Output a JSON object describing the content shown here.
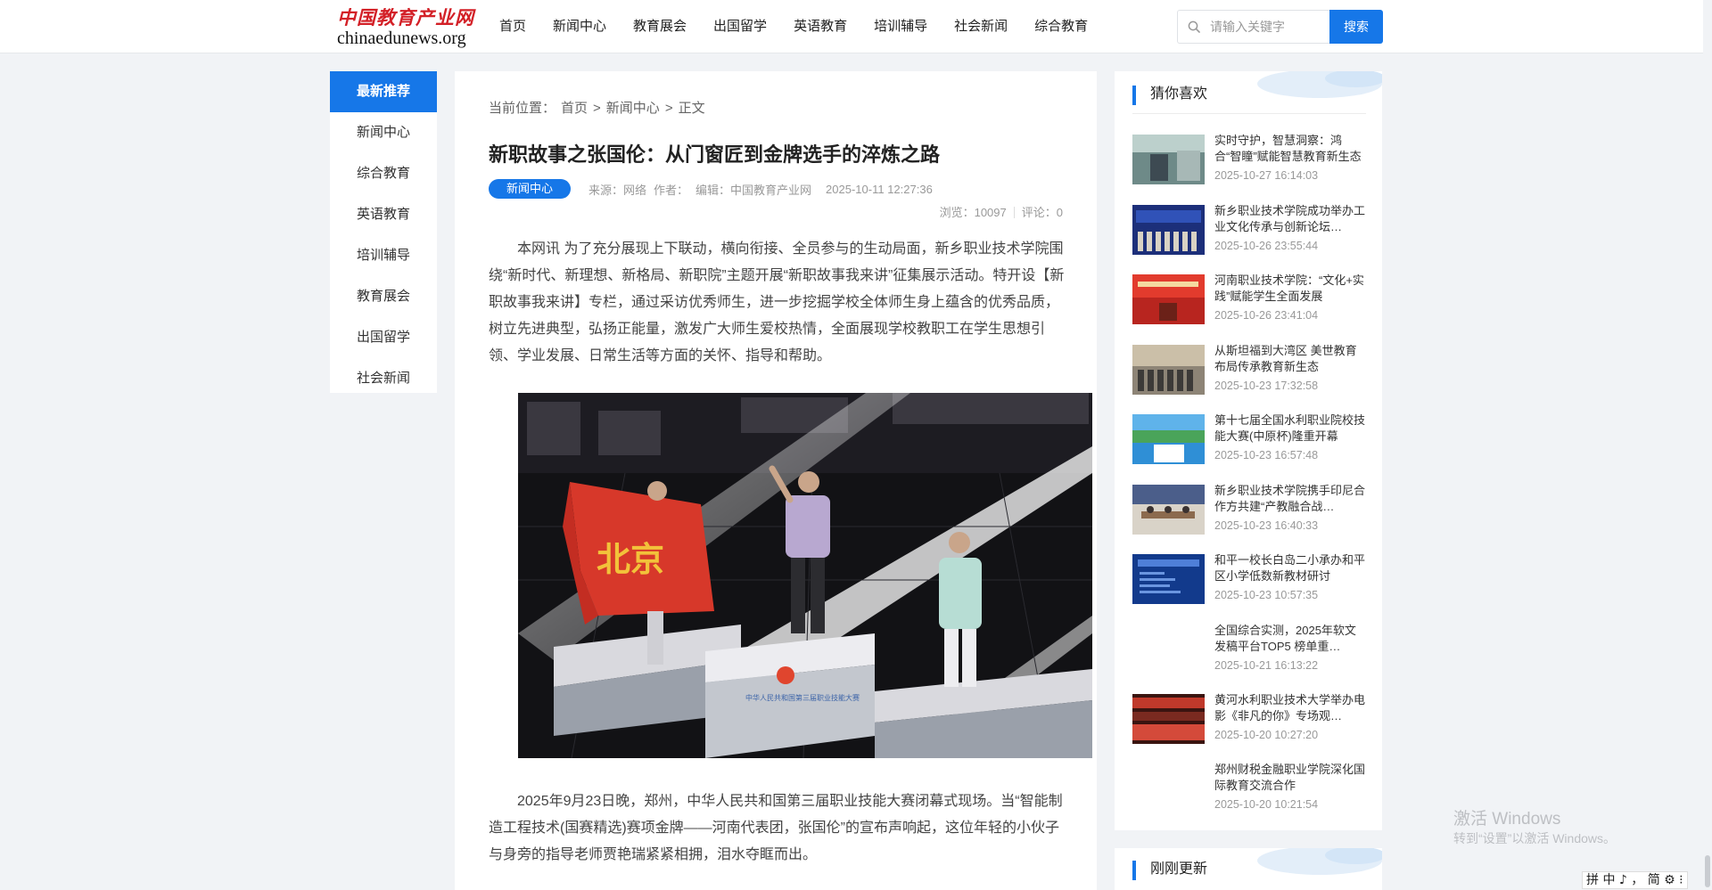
{
  "logo": {
    "cn": "中国教育产业网",
    "en": "chinaedunews.org"
  },
  "nav": {
    "items": [
      "首页",
      "新闻中心",
      "教育展会",
      "出国留学",
      "英语教育",
      "培训辅导",
      "社会新闻",
      "综合教育"
    ]
  },
  "search": {
    "placeholder": "请输入关键字",
    "button": "搜索"
  },
  "side_menu": {
    "items": [
      "最新推荐",
      "新闻中心",
      "综合教育",
      "英语教育",
      "培训辅导",
      "教育展会",
      "出国留学",
      "社会新闻"
    ],
    "active_index": 0
  },
  "breadcrumb": {
    "prefix": "当前位置：",
    "home": "首页",
    "sep": ">",
    "section": "新闻中心",
    "current": "正文"
  },
  "article": {
    "title": "新职故事之张国伦：从门窗匠到金牌选手的淬炼之路",
    "category": "新闻中心",
    "source": "来源：网络",
    "author": "作者：",
    "editor": "编辑：中国教育产业网",
    "date": "2025-10-11 12:27:36",
    "views_label": "浏览：",
    "views": "10097",
    "comments_label": "评论：",
    "comments": "0",
    "para1": "本网讯 为了充分展现上下联动，横向衔接、全员参与的生动局面，新乡职业技术学院围绕“新时代、新理想、新格局、新职院”主题开展“新职故事我来讲”征集展示活动。特开设【新职故事我来讲】专栏，通过采访优秀师生，进一步挖掘学校全体师生身上蕴含的优秀品质，树立先进典型，弘扬正能量，激发广大师生爱校热情，全面展现学校教职工在学生思想引领、学业发展、日常生活等方面的关怀、指导和帮助。",
    "photo_flag_text": "北京",
    "para2": "2025年9月23日晚，郑州，中华人民共和国第三届职业技能大赛闭幕式现场。当“智能制造工程技术(国赛精选)赛项金牌——河南代表团，张国伦”的宣布声响起，这位年轻的小伙子与身旁的指导老师贾艳瑞紧紧相拥，泪水夺眶而出。"
  },
  "recommend": {
    "title": "猜你喜欢",
    "items": [
      {
        "title": "实时守护，智慧洞察：鸿合“智瞳”赋能智慧教育新生态",
        "time": "2025-10-27 16:14:03",
        "thumb": "lab"
      },
      {
        "title": "新乡职业技术学院成功举办工业文化传承与创新论坛…",
        "time": "2025-10-26 23:55:44",
        "thumb": "stage-blue"
      },
      {
        "title": "河南职业技术学院：“文化+实践”赋能学生全面发展",
        "time": "2025-10-26 23:41:04",
        "thumb": "stage-red"
      },
      {
        "title": "从斯坦福到大湾区 美世教育布局传承教育新生态",
        "time": "2025-10-23 17:32:58",
        "thumb": "group"
      },
      {
        "title": "第十七届全国水利职业院校技能大赛(中原杯)隆重开幕",
        "time": "2025-10-23 16:57:48",
        "thumb": "field"
      },
      {
        "title": "新乡职业技术学院携手印尼合作方共建“产教融合战…",
        "time": "2025-10-23 16:40:33",
        "thumb": "meeting"
      },
      {
        "title": "和平一校长白岛二小承办和平区小学低数新教材研讨",
        "time": "2025-10-23 10:57:35",
        "thumb": "screen"
      },
      {
        "title": "全国综合实测，2025年软文发稿平台TOP5 榜单重…",
        "time": "2025-10-21 16:13:22",
        "thumb": "none"
      },
      {
        "title": "黄河水利职业技术大学举办电影《非凡的你》专场观…",
        "time": "2025-10-20 10:27:20",
        "thumb": "cinema"
      },
      {
        "title": "郑州财税金融职业学院深化国际教育交流合作",
        "time": "2025-10-20 10:21:54",
        "thumb": "none"
      }
    ]
  },
  "latest": {
    "title": "刚刚更新"
  },
  "windows": {
    "title": "激活 Windows",
    "subtitle": "转到“设置”以激活 Windows。"
  },
  "ime": {
    "text": "拼 中 ♪ ， 简 ⚙ ⁝"
  }
}
